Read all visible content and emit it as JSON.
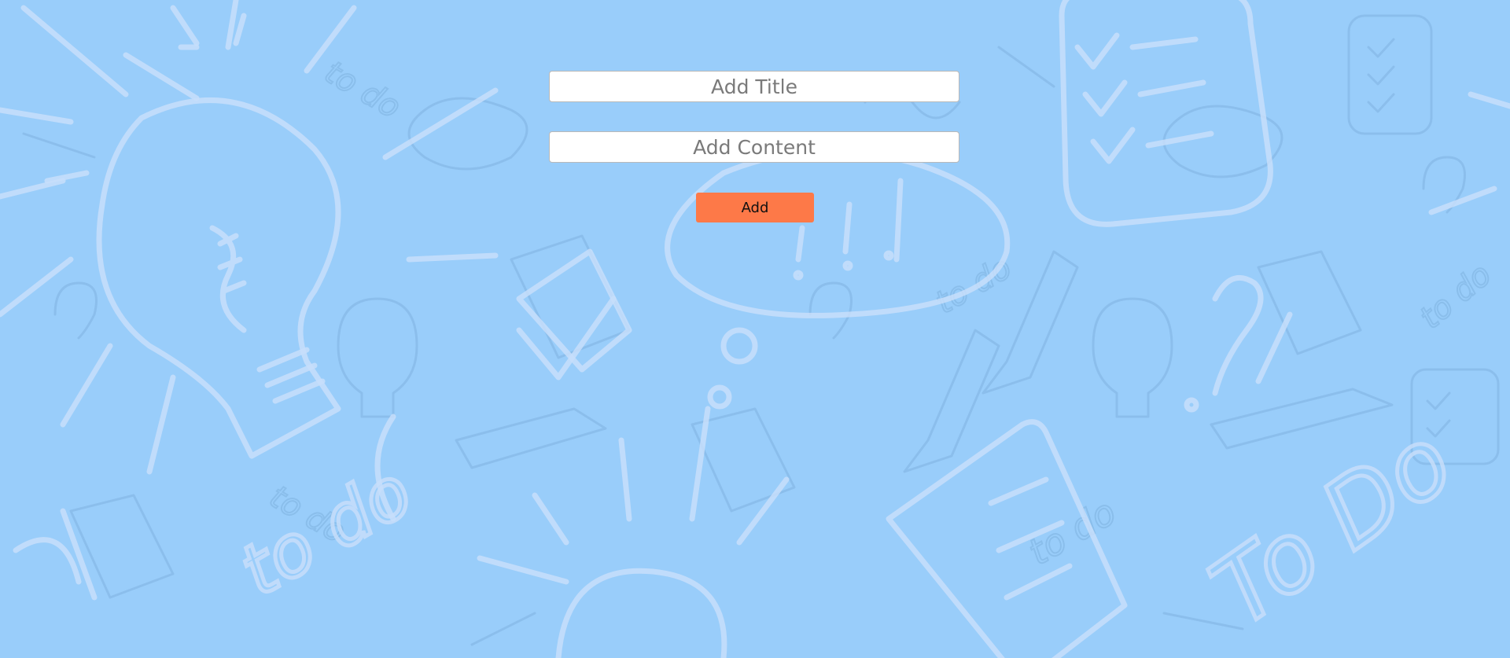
{
  "form": {
    "title_placeholder": "Add Title",
    "content_placeholder": "Add Content",
    "add_label": "Add"
  },
  "colors": {
    "background": "#99cdfa",
    "button": "#fd7948",
    "doodle_light": "#c7defa",
    "doodle_dark": "#7fb3e0"
  },
  "background": {
    "pattern": "todo-doodles",
    "doodle_text": "to do"
  }
}
